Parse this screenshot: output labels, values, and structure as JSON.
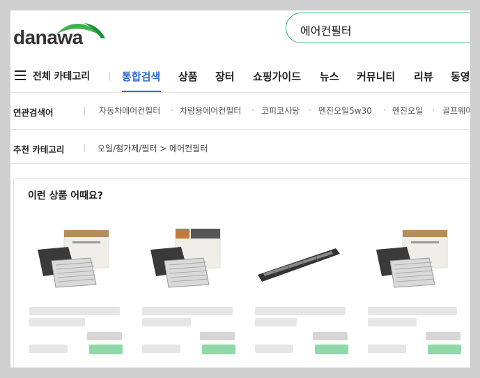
{
  "logo": {
    "text": "danawa"
  },
  "search": {
    "value": "에어컨필터"
  },
  "nav": {
    "all_categories": "전체 카테고리",
    "items": [
      "통합검색",
      "상품",
      "장터",
      "쇼핑가이드",
      "뉴스",
      "커뮤니티",
      "리뷰",
      "동영상"
    ],
    "active": "통합검색"
  },
  "related": {
    "title": "연관검색어",
    "tags": [
      "자동차에어컨필터",
      "차량용에어컨필터",
      "코피코사탕",
      "엔진오일5w30",
      "엔진오일",
      "골프웨어"
    ]
  },
  "recommended_category": {
    "title": "추천 카테고리",
    "path": "오일/첨가제/필터 > 에어컨필터"
  },
  "recommendations": {
    "title": "이런 상품 어때요?",
    "products": [
      {
        "image": "cabin-filter-box"
      },
      {
        "image": "cabin-filter-box-ac"
      },
      {
        "image": "long-cabin-filter"
      },
      {
        "image": "cabin-filter-box"
      }
    ]
  },
  "colors": {
    "accent": "#2a6bd4",
    "brand_green": "#2dbb6e"
  }
}
